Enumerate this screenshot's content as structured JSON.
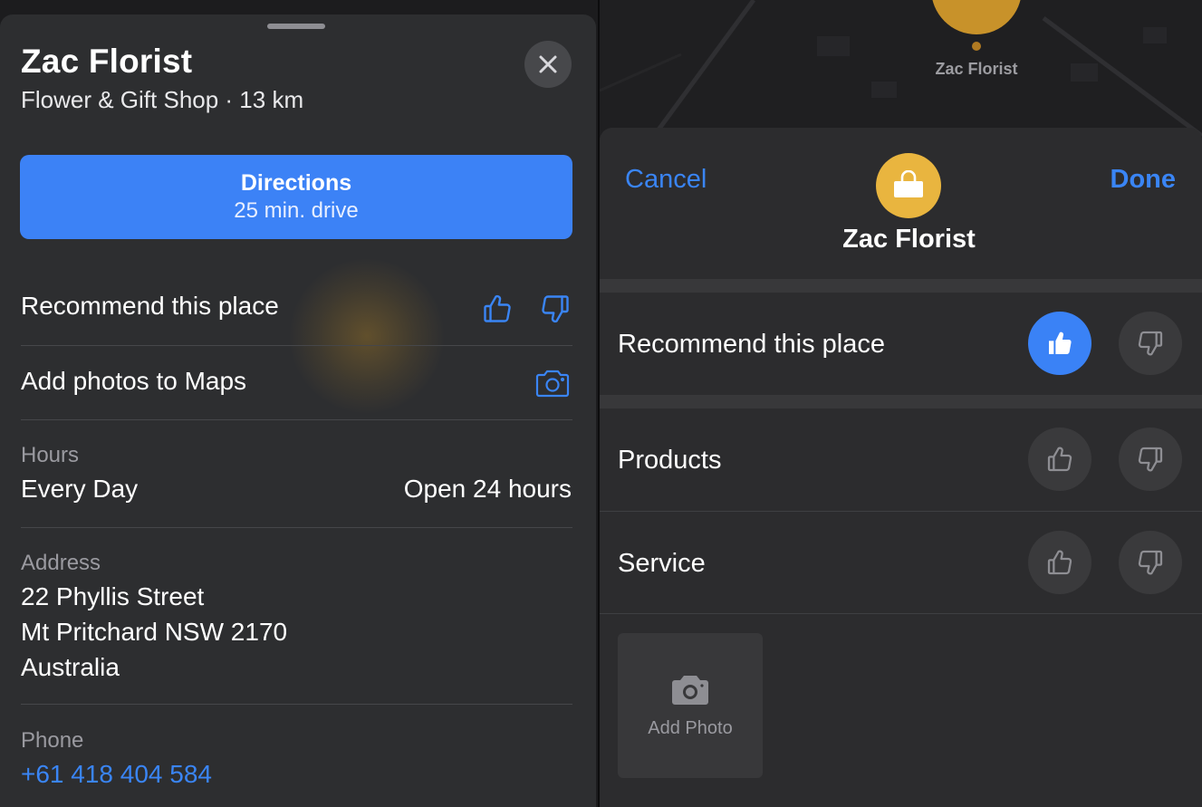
{
  "left": {
    "title": "Zac Florist",
    "subtitle": "Flower & Gift Shop · 13 km",
    "directions": {
      "title": "Directions",
      "subtitle": "25 min. drive"
    },
    "recommend_label": "Recommend this place",
    "add_photos_label": "Add photos to Maps",
    "hours": {
      "label": "Hours",
      "day": "Every Day",
      "value": "Open 24 hours"
    },
    "address": {
      "label": "Address",
      "line1": "22 Phyllis Street",
      "line2": "Mt Pritchard NSW 2170",
      "line3": "Australia"
    },
    "phone": {
      "label": "Phone",
      "number": "+61 418 404 584"
    }
  },
  "right": {
    "map_label": "Zac Florist",
    "cancel_label": "Cancel",
    "done_label": "Done",
    "place_name": "Zac Florist",
    "badge_icon": "shopping-bag-icon",
    "rows": [
      {
        "label": "Recommend this place",
        "rating": "thumbs-up"
      },
      {
        "label": "Products",
        "rating": "none"
      },
      {
        "label": "Service",
        "rating": "none"
      }
    ],
    "add_photo_label": "Add Photo"
  },
  "colors": {
    "accent": "#3a85f5",
    "sheet": "#2d2e30",
    "badge": "#e9b53f",
    "pin": "#c8922a"
  }
}
